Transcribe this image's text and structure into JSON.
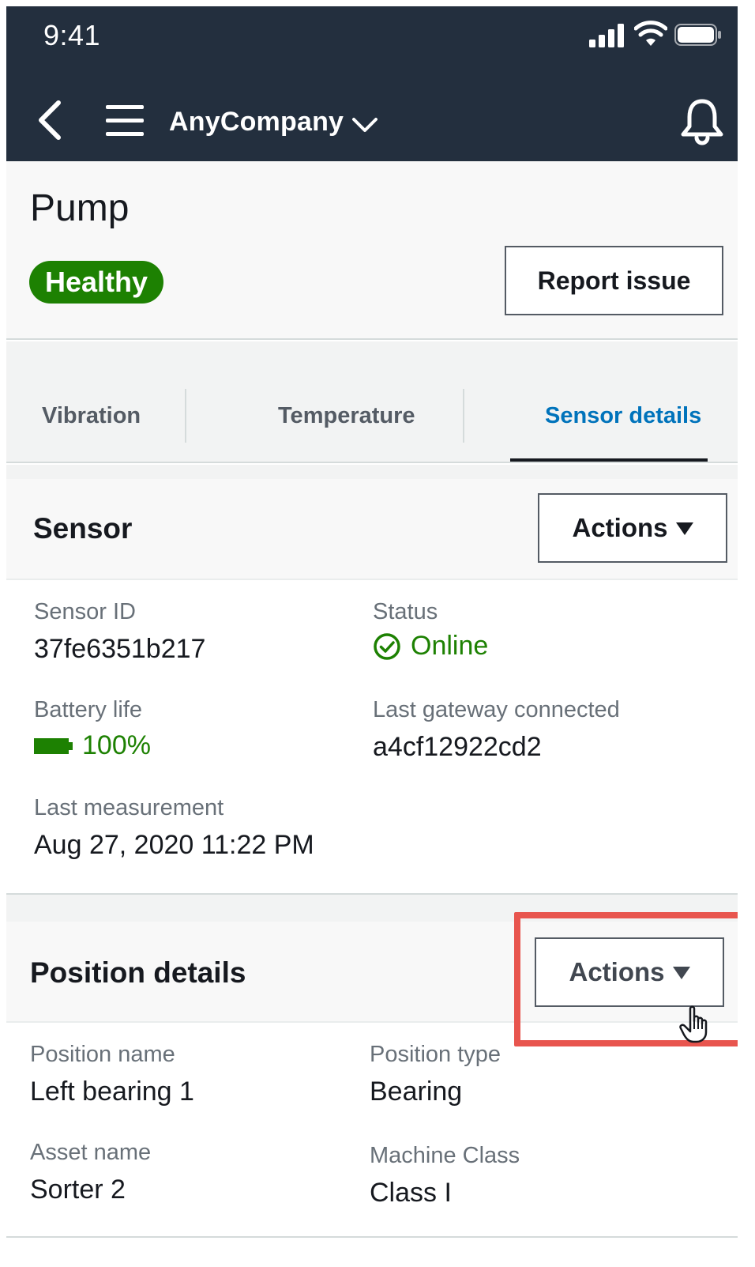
{
  "status_bar": {
    "time": "9:41"
  },
  "nav": {
    "company": "AnyCompany",
    "icons": [
      "back-icon",
      "menu-icon",
      "chevron-down-icon",
      "bell-icon"
    ]
  },
  "asset": {
    "title": "Pump",
    "status_badge": "Healthy",
    "report_button": "Report issue"
  },
  "tabs": [
    {
      "label": "Vibration",
      "selected": false
    },
    {
      "label": "Temperature",
      "selected": false
    },
    {
      "label": "Sensor details",
      "selected": true
    }
  ],
  "sensor_panel": {
    "title": "Sensor",
    "actions_label": "Actions",
    "fields": {
      "sensor_id": {
        "label": "Sensor ID",
        "value": "37fe6351b217"
      },
      "status": {
        "label": "Status",
        "value": "Online"
      },
      "battery": {
        "label": "Battery life",
        "value": "100%"
      },
      "gateway": {
        "label": "Last gateway connected",
        "value": "a4cf12922cd2"
      },
      "measurement": {
        "label": "Last measurement",
        "value": "Aug 27, 2020 11:22 PM"
      }
    }
  },
  "position_panel": {
    "title": "Position details",
    "actions_label": "Actions",
    "fields": {
      "position_name": {
        "label": "Position name",
        "value": "Left bearing 1"
      },
      "position_type": {
        "label": "Position type",
        "value": "Bearing"
      },
      "asset_name": {
        "label": "Asset name",
        "value": "Sorter 2"
      },
      "machine_class": {
        "label": "Machine Class",
        "value": "Class I"
      }
    }
  },
  "colors": {
    "nav_bg": "#232f3e",
    "healthy_green": "#1d8102",
    "active_tab_blue": "#0073bb",
    "highlight_red": "#e8554e"
  }
}
